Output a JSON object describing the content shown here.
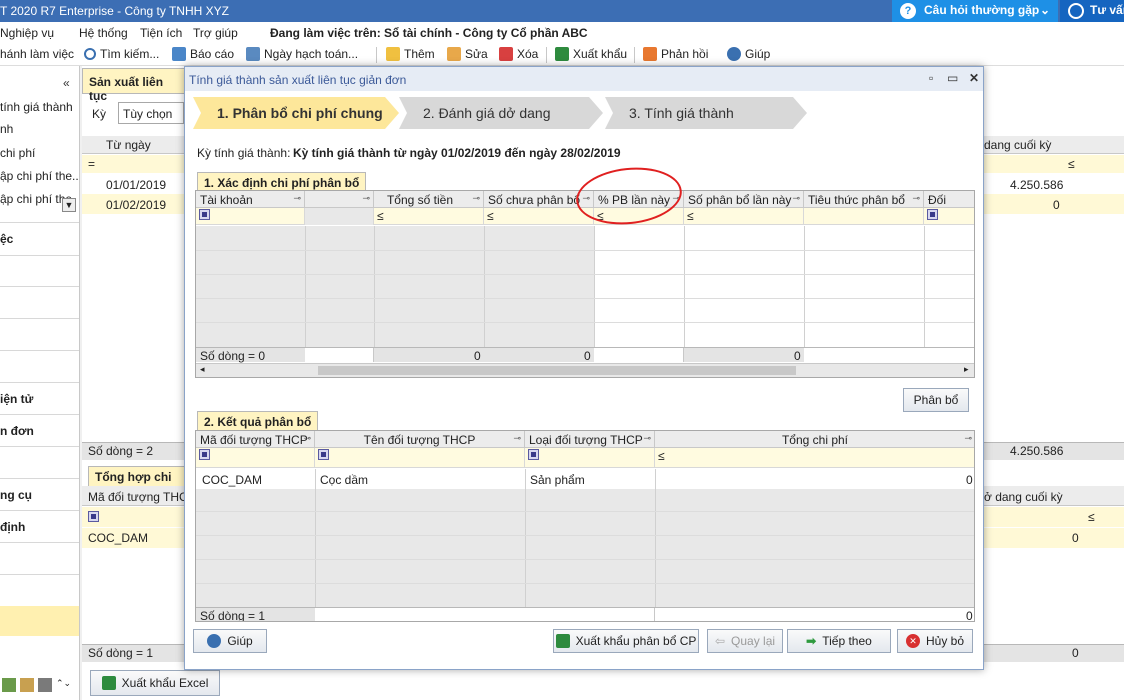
{
  "app": {
    "title": "T 2020 R7 Enterprise - Công ty TNHH XYZ",
    "help_button": "Câu hỏi thường gặp",
    "consult_button": "Tư vấn"
  },
  "menu": {
    "items": [
      "Nghiệp vụ",
      "Hệ thống",
      "Tiện ích",
      "Trợ giúp"
    ],
    "working_on": "Đang làm việc trên: Sổ tài chính - Công ty Cổ phần ABC"
  },
  "toolbar": {
    "items": [
      "hánh làm việc",
      "Tìm kiếm...",
      "Báo cáo",
      "Ngày hạch toán...",
      "Thêm",
      "Sửa",
      "Xóa",
      "Xuất khẩu",
      "Phản hồi",
      "Giúp"
    ]
  },
  "left_panel": {
    "collapse": "«",
    "items": [
      "tính giá thành",
      "nh",
      "chi phí",
      "ập chi phí the...",
      "ập chi phí the"
    ],
    "sections": [
      "ệc",
      "iện tử",
      "n đơn",
      "ng cụ",
      "định"
    ]
  },
  "background": {
    "tab_title": "Sản xuất liên tục",
    "period_label": "Kỳ",
    "period_value": "Tùy chọn",
    "col_from": "Từ ngày",
    "col_closing": "dang cuối kỳ",
    "filter_eq": "=",
    "filter_le": "≤",
    "rows": [
      {
        "date": "01/01/2019",
        "amount": "4.250.586"
      },
      {
        "date": "01/02/2019",
        "amount": "0"
      }
    ],
    "row_count": "Số dòng = 2",
    "row_total": "4.250.586",
    "summary_tab": "Tổng hợp chi phí",
    "summary_col_code": "Mã đối tượng THCP",
    "summary_col_closing": "ở dang cuối kỳ",
    "summary_row_code": "COC_DAM",
    "summary_row_value": "0",
    "summary_count": "Số dòng = 1",
    "summary_total": "0",
    "export_excel": "Xuất khẩu Excel"
  },
  "dialog": {
    "title": "Tính giá thành sản xuất liên tục giản đơn",
    "steps": [
      "1. Phân bổ chi phí chung",
      "2. Đánh giá dở dang",
      "3. Tính giá thành"
    ],
    "period_label": "Kỳ tính giá thành:",
    "period_value": "Kỳ tính giá thành từ ngày 01/02/2019 đến ngày 28/02/2019",
    "section1": {
      "title": "1. Xác định chi phí phân bổ",
      "columns": [
        "Tài khoản",
        "",
        "Tổng số tiền",
        "Số chưa phân bổ",
        "% PB lần này",
        "Số phân bổ lần này",
        "Tiêu thức phân bổ",
        "Đối"
      ],
      "filter_le": "≤",
      "row_count": "Số dòng = 0",
      "totals": [
        "0",
        "0",
        "0"
      ]
    },
    "allocate_button": "Phân bổ",
    "section2": {
      "title": "2. Kết quả phân bổ",
      "columns": [
        "Mã đối tượng THCP",
        "Tên đối tượng THCP",
        "Loại đối tượng THCP",
        "Tổng chi phí"
      ],
      "filter_le": "≤",
      "rows": [
        {
          "code": "COC_DAM",
          "name": "Cọc dầm",
          "type": "Sản phẩm",
          "total": "0"
        }
      ],
      "row_count": "Số dòng = 1",
      "total": "0"
    },
    "buttons": {
      "help": "Giúp",
      "export_allocation": "Xuất khẩu phân bổ CP",
      "back": "Quay lại",
      "next": "Tiếp theo",
      "cancel": "Hủy bỏ"
    }
  },
  "colors": {
    "titlebar": "#3c6eb4",
    "accent_yellow": "#fff4c2",
    "annotation_red": "#e02020"
  }
}
